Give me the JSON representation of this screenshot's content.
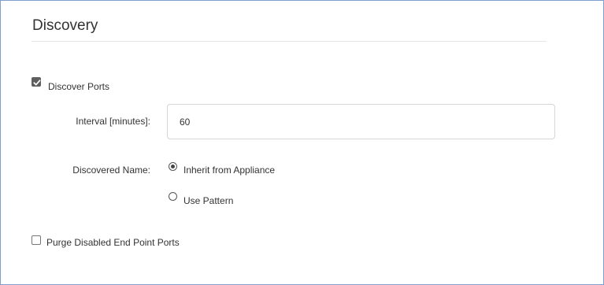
{
  "section": {
    "title": "Discovery"
  },
  "discover_ports": {
    "label": "Discover Ports",
    "checked": true
  },
  "interval": {
    "label": "Interval [minutes]:",
    "value": "60"
  },
  "discovered_name": {
    "label": "Discovered Name:",
    "options": [
      {
        "label": "Inherit from Appliance",
        "selected": true
      },
      {
        "label": "Use Pattern",
        "selected": false
      }
    ]
  },
  "purge_disabled": {
    "label": "Purge Disabled End Point Ports",
    "checked": false
  },
  "colors": {
    "frame_border": "#7f9fce",
    "checkbox_checked": "#5f5f5f",
    "text": "#333333"
  }
}
